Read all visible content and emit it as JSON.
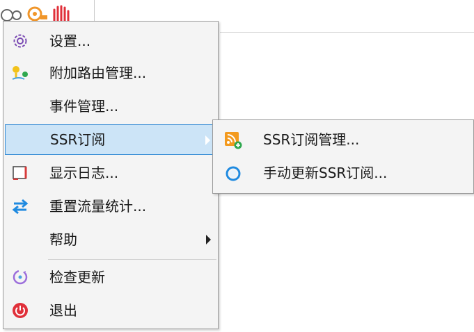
{
  "tray": {
    "icons": [
      "gear-outline-icon",
      "orange-gear-icon",
      "red-hand-icon"
    ]
  },
  "menu": {
    "items": [
      {
        "label": "设置...",
        "icon": "gear-icon"
      },
      {
        "label": "附加路由管理...",
        "icon": "route-pin-icon"
      },
      {
        "label": "事件管理...",
        "icon": ""
      },
      {
        "label": "SSR订阅",
        "icon": "",
        "submenu": true,
        "highlighted": true
      },
      {
        "label": "显示日志...",
        "icon": "log-window-icon"
      },
      {
        "label": "重置流量统计...",
        "icon": "reset-arrows-icon"
      },
      {
        "label": "帮助",
        "icon": "",
        "submenu": true
      },
      {
        "label": "检查更新",
        "icon": "check-update-icon"
      },
      {
        "label": "退出",
        "icon": "power-icon"
      }
    ]
  },
  "submenu": {
    "items": [
      {
        "label": "SSR订阅管理...",
        "icon": "rss-add-icon"
      },
      {
        "label": "手动更新SSR订阅...",
        "icon": "refresh-circle-icon"
      }
    ]
  },
  "colors": {
    "highlight_bg": "#cce4f7",
    "highlight_border": "#3b8fd6",
    "menu_bg": "#f4f4f4",
    "exit_red": "#e0303a",
    "reset_blue": "#1f8ae0"
  }
}
